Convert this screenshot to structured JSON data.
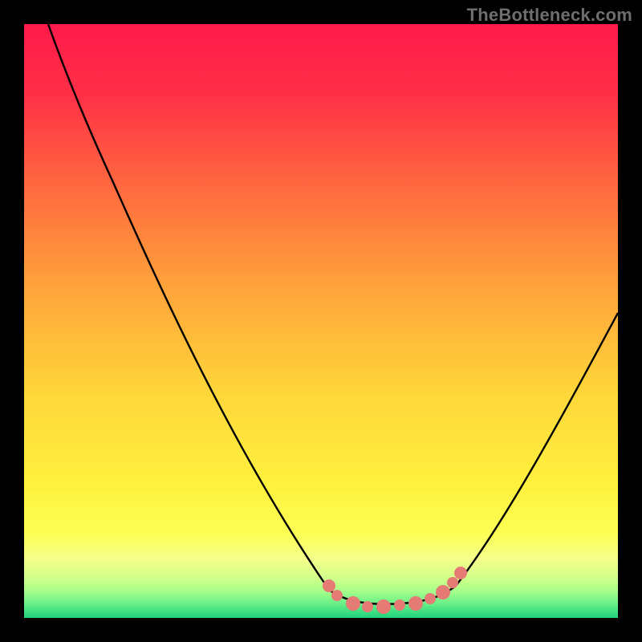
{
  "watermark": "TheBottleneck.com",
  "colors": {
    "gradient_top": "#ff1a4a",
    "gradient_mid": "#ffd63a",
    "gradient_bottom": "#1fd37a",
    "curve": "#000000",
    "highlight": "#e67a74",
    "frame": "#000000"
  },
  "chart_data": {
    "type": "line",
    "title": "",
    "xlabel": "",
    "ylabel": "",
    "xlim": [
      0,
      100
    ],
    "ylim": [
      0,
      100
    ],
    "notes": "Background is a vertical heatmap gradient from red (top, y≈100) through orange/yellow to green (bottom, y≈0). A black V-shaped curve descends from upper-left to a minimum near x≈60 and rises toward the right edge. A salmon-colored dotted segment highlights the flat bottom region of the curve.",
    "series": [
      {
        "name": "curve",
        "x": [
          4,
          10,
          15,
          20,
          25,
          30,
          35,
          40,
          45,
          50,
          55,
          58,
          60,
          63,
          66,
          70,
          75,
          80,
          85,
          90,
          95,
          100
        ],
        "y": [
          100,
          90,
          81,
          73,
          65,
          56,
          48,
          39,
          31,
          22,
          13,
          8,
          4,
          3,
          3,
          5,
          10,
          18,
          27,
          36,
          45,
          52
        ]
      },
      {
        "name": "highlight-region",
        "x": [
          51,
          53,
          55,
          58,
          60,
          63,
          66,
          68,
          70,
          72,
          74
        ],
        "y": [
          6,
          4,
          3,
          2.2,
          2,
          2,
          2.2,
          2.6,
          3.4,
          4.4,
          6
        ]
      }
    ]
  }
}
